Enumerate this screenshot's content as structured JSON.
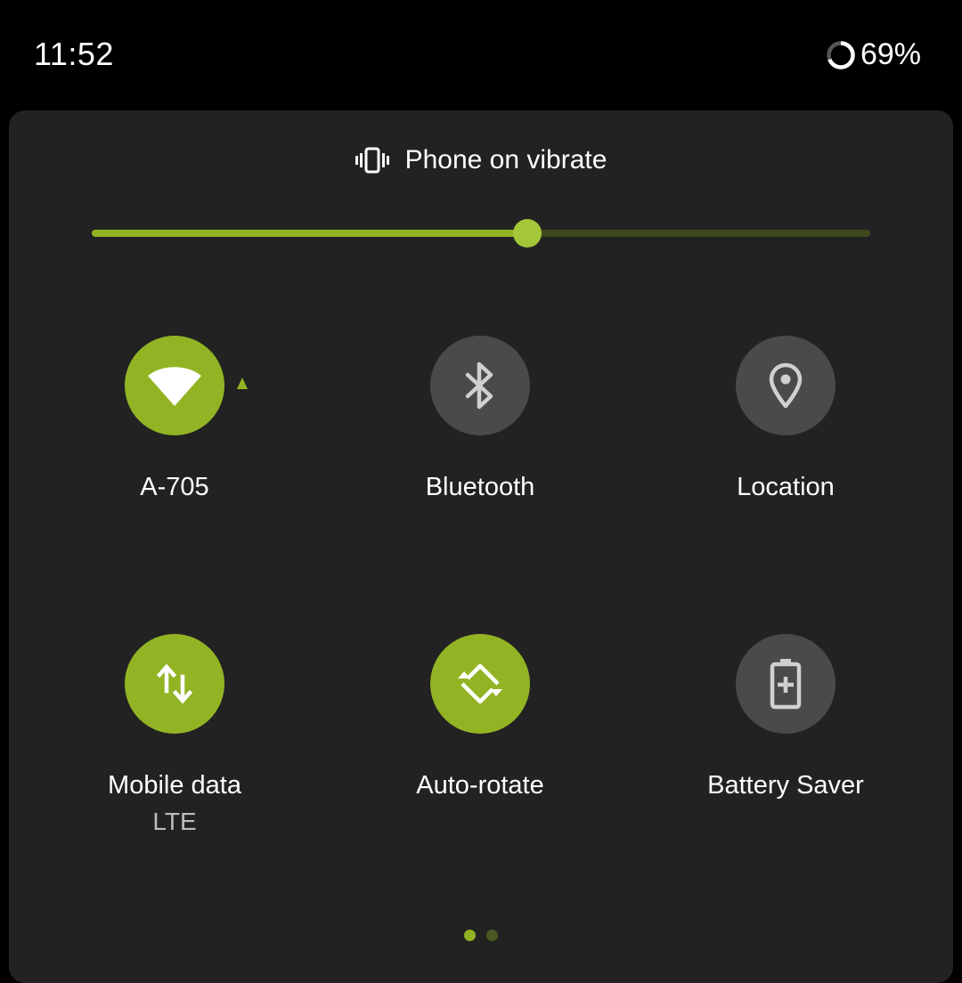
{
  "status_bar": {
    "time": "11:52",
    "battery_percent": "69%",
    "battery_level": 0.69
  },
  "ringer": {
    "icon": "vibrate-icon",
    "label": "Phone on vibrate"
  },
  "brightness": {
    "level": 0.56
  },
  "tiles": [
    {
      "icon": "wifi-icon",
      "label": "A-705",
      "state": "on",
      "activity_indicator": true
    },
    {
      "icon": "bluetooth-icon",
      "label": "Bluetooth",
      "state": "off"
    },
    {
      "icon": "location-icon",
      "label": "Location",
      "state": "off"
    },
    {
      "icon": "mobile-data-icon",
      "label": "Mobile data",
      "sublabel": "LTE",
      "state": "on"
    },
    {
      "icon": "auto-rotate-icon",
      "label": "Auto-rotate",
      "state": "on"
    },
    {
      "icon": "battery-saver-icon",
      "label": "Battery Saver",
      "state": "off"
    }
  ],
  "pager": {
    "pages": 2,
    "current": 1
  },
  "colors": {
    "accent": "#92b424",
    "tile_off": "#4a4a4a",
    "panel": "#222222",
    "background": "#000000",
    "icon_off": "#d0d0d0"
  }
}
